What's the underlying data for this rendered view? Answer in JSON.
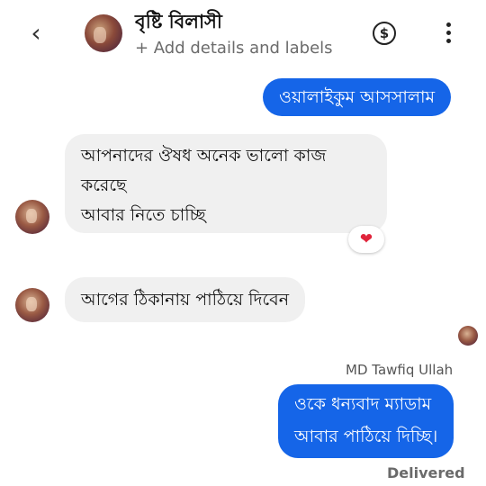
{
  "header": {
    "back_icon": "chevron-left-icon",
    "back_glyph": "‹",
    "contact_name": "বৃষ্টি বিলাসী",
    "subtitle": "+ Add details and labels",
    "dollar_glyph": "$",
    "dollar_icon": "dollar-circle-icon",
    "more_icon": "more-vertical-icon"
  },
  "messages": [
    {
      "direction": "outgoing",
      "lines": [
        "ওয়ালাইকুম আসসালাম"
      ]
    },
    {
      "direction": "incoming",
      "lines": [
        "আপনাদের  ঔষধ অনেক ভালো কাজ",
        "করেছে",
        "আবার নিতে চাচ্ছি"
      ],
      "reaction": "❤"
    },
    {
      "direction": "incoming",
      "lines": [
        "আগের ঠিকানায় পাঠিয়ে দিবেন"
      ]
    },
    {
      "direction": "outgoing",
      "sender": "MD Tawfiq Ullah",
      "lines": [
        "ওকে ধন্যবাদ ম্যাডাম",
        "আবার পাঠিয়ে দিচ্ছি।"
      ],
      "status": "Delivered"
    }
  ],
  "colors": {
    "outgoing_bubble": "#1565e8",
    "incoming_bubble": "#f0f0f0",
    "reaction_heart": "#e0243b"
  }
}
